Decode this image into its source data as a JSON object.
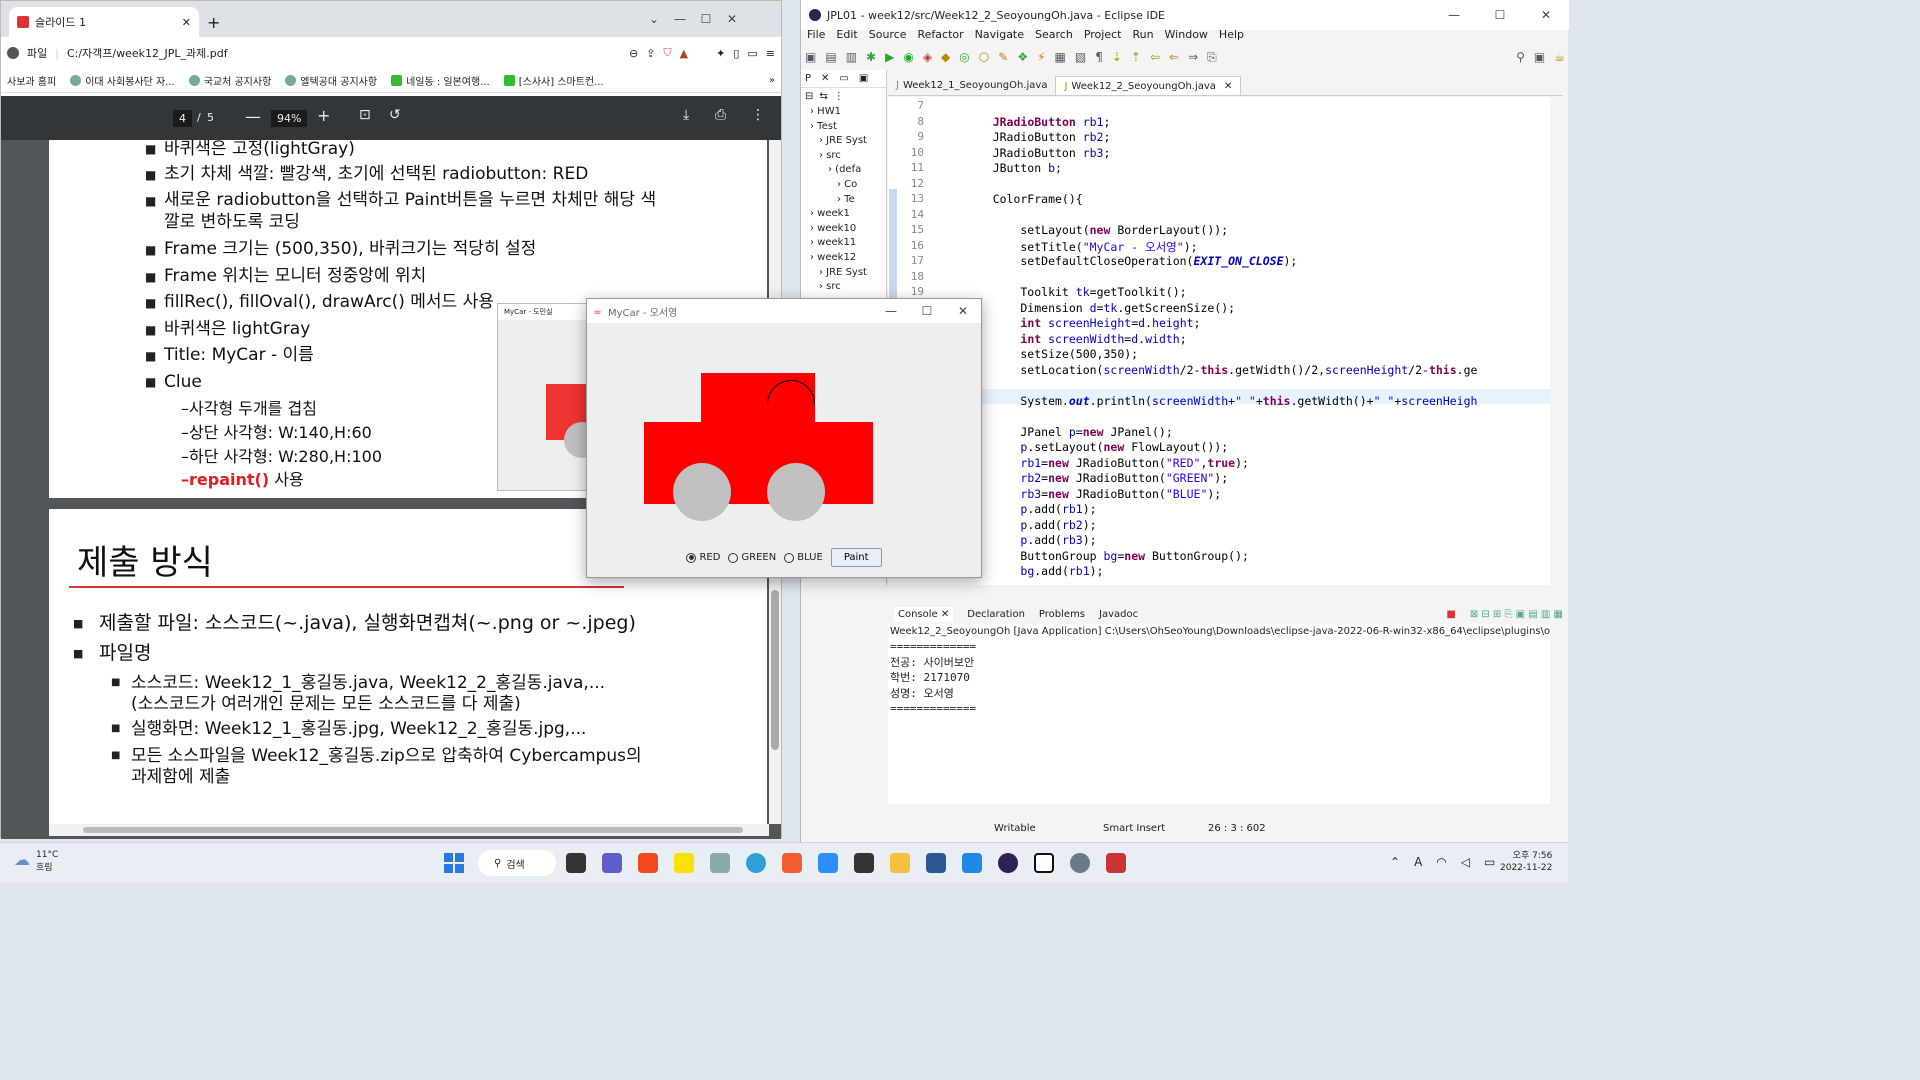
{
  "browser": {
    "tab_title": "슬라이드 1",
    "address_prefix": "파일",
    "address": "C:/자객프/week12_JPL_과제.pdf",
    "bookmarks": [
      "사보과 홈피",
      "이대 사회봉사단 자...",
      "국교처 공지사항",
      "엘텍공대 공지사항",
      "네일동 : 일본여행...",
      "[스사사] 스마트컨..."
    ],
    "page_current": "4",
    "page_sep": "/",
    "page_total": "5",
    "zoom": "94%"
  },
  "slide1": {
    "bullets": [
      "바퀴색은 고정(lightGray)",
      "초기 차체 색깔: 빨강색, 초기에 선택된 radiobutton: RED",
      "새로운 radiobutton을 선택하고 Paint버튼을 누르면 차체만 해당 색",
      "깔로 변하도록 코딩",
      "Frame 크기는 (500,350), 바퀴크기는 적당히 설정",
      "Frame 위치는 모니터 정중앙에 위치",
      "fillRec(), fillOval(), drawArc() 메서드 사용",
      "바퀴색은 lightGray",
      "Title: MyCar - 이름",
      "Clue"
    ],
    "clue": [
      "–사각형 두개를 겹침",
      "–상단 사각형: W:140,H:60",
      "–하단 사각형: W:280,H:100"
    ],
    "repaint": "–repaint()",
    "repaint_suffix": " 사용",
    "thumb_title": "MyCar - 도민실"
  },
  "slide2": {
    "title": "제출 방식",
    "b1": "제출할 파일: 소스코드(~.java), 실행화면캡쳐(~.png or ~.jpeg)",
    "b2": "파일명",
    "s1": "소스코드: Week12_1_홍길동.java, Week12_2_홍길동.java,...",
    "s1b": "(소스코드가 여러개인 문제는 모든 소스코드를 다 제출)",
    "s2": "실행화면: Week12_1_홍길동.jpg, Week12_2_홍길동.jpg,...",
    "s3": "모든 소스파일을 Week12_홍길동.zip으로 압축하여 Cybercampus의",
    "s3b": "과제함에 제출"
  },
  "mycar": {
    "title": "MyCar - 오서영",
    "radios": [
      "RED",
      "GREEN",
      "BLUE"
    ],
    "selected": "RED",
    "paint": "Paint",
    "body_color": "#ff0000",
    "wheel_color": "#c0c0c0"
  },
  "eclipse": {
    "title": "JPL01 - week12/src/Week12_2_SeoyoungOh.java - Eclipse IDE",
    "menu": [
      "File",
      "Edit",
      "Source",
      "Refactor",
      "Navigate",
      "Search",
      "Project",
      "Run",
      "Window",
      "Help"
    ],
    "editor_tabs": [
      "Week12_1_SeoyoungOh.java",
      "Week12_2_SeoyoungOh.java"
    ],
    "tree": [
      "HW1",
      "Test",
      "JRE Syst",
      "src",
      "(defa",
      "Co",
      "Te",
      "week1",
      "week10",
      "week11",
      "week12",
      "JRE Syst",
      "src"
    ],
    "pe_tab": "P",
    "console_tabs": [
      "Console",
      "Declaration",
      "Problems",
      "Javadoc"
    ],
    "console_header": "Week12_2_SeoyoungOh [Java Application] C:\\Users\\OhSeoYoung\\Downloads\\eclipse-java-2022-06-R-win32-x86_64\\eclipse\\plugins\\org.eclipse.jus",
    "console_lines": [
      "=============",
      "전공: 사이버보안",
      "학번: 2171070",
      "성명: 오서영",
      "============="
    ],
    "status": [
      "Writable",
      "Smart Insert",
      "26 : 3 : 602"
    ]
  },
  "taskbar": {
    "weather_temp": "11°C",
    "weather_desc": "흐림",
    "search": "검색",
    "time": "오후 7:56",
    "date": "2022-11-22"
  }
}
